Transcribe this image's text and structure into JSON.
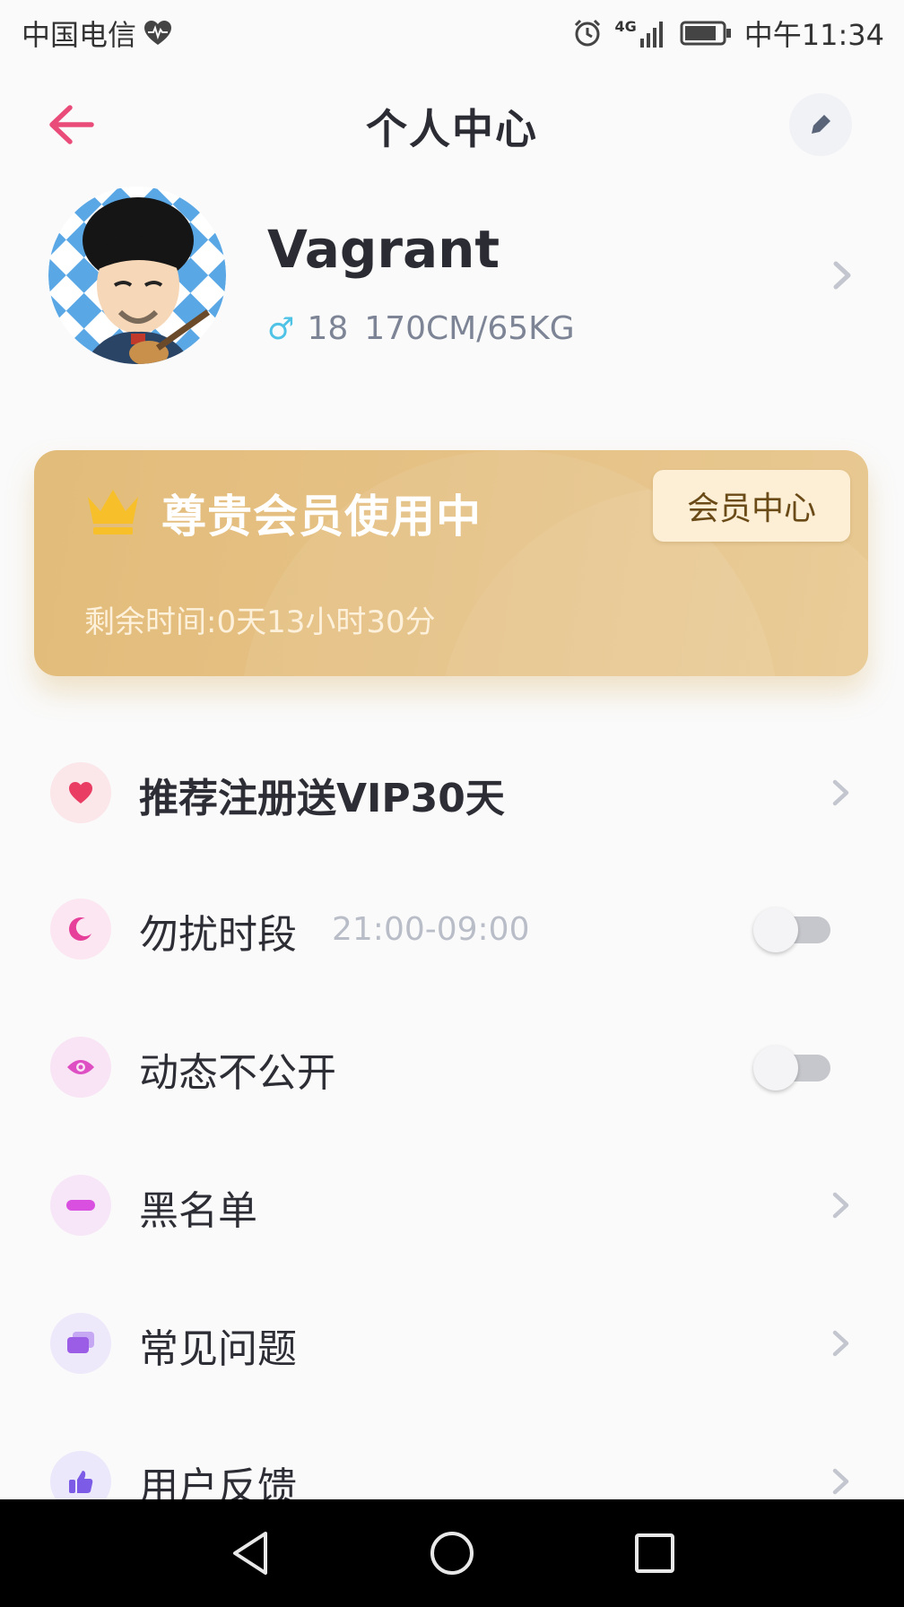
{
  "status_bar": {
    "carrier": "中国电信",
    "time": "中午11:34",
    "network": "4G",
    "icons": [
      "heart-pulse-icon",
      "alarm-icon",
      "signal-icon",
      "battery-icon"
    ]
  },
  "header": {
    "title": "个人中心",
    "back_icon": "arrow-left-icon",
    "edit_icon": "edit-icon"
  },
  "profile": {
    "name": "Vagrant",
    "gender_symbol": "♂",
    "age": "18",
    "body": "170CM/65KG"
  },
  "vip": {
    "title": "尊贵会员使用中",
    "remaining": "剩余时间:0天13小时30分",
    "button": "会员中心"
  },
  "menu": {
    "items": [
      {
        "label": "推荐注册送VIP30天",
        "icon": "heart-icon",
        "action": "chevron"
      },
      {
        "label": "勿扰时段",
        "extra": "21:00-09:00",
        "icon": "moon-icon",
        "action": "toggle",
        "toggle_on": false
      },
      {
        "label": "动态不公开",
        "icon": "eye-icon",
        "action": "toggle",
        "toggle_on": false
      },
      {
        "label": "黑名单",
        "icon": "minus-icon",
        "action": "chevron"
      },
      {
        "label": "常见问题",
        "icon": "question-card-icon",
        "action": "chevron"
      },
      {
        "label": "用户反馈",
        "icon": "thumbs-up-icon",
        "action": "chevron"
      }
    ]
  },
  "colors": {
    "accent": "#ea4c7a",
    "vip_gold": "#e4bf7f",
    "background": "#fafafa"
  }
}
